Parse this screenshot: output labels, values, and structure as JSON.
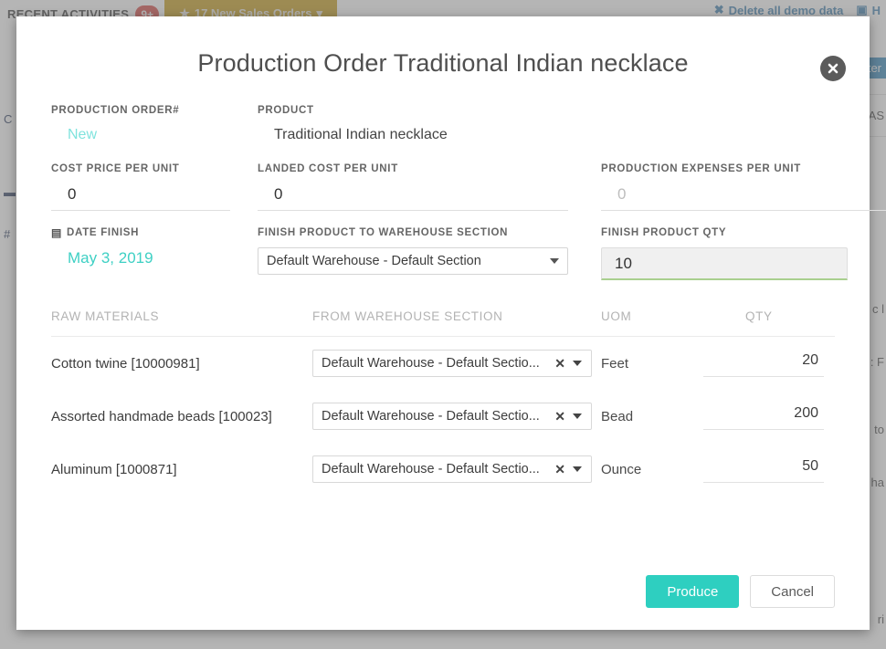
{
  "background": {
    "recent_activities_label": "RECENT ACTIVITIES",
    "recent_activities_badge": "9+",
    "gold_tab_label": "17 New Sales Orders",
    "gold_tab_icon": "star-icon",
    "gold_tab_caret": "▾",
    "right_links": [
      {
        "icon": "trash-icon",
        "label": "Delete all demo data"
      },
      {
        "icon": "help-icon",
        "label": "H"
      }
    ],
    "right_chip_label": "ter",
    "right_fragments": [
      "AS",
      "c l",
      ": F",
      "to",
      "ha",
      "ri"
    ],
    "left_rail_marks": [
      "C",
      "▬",
      "#"
    ]
  },
  "modal": {
    "title": "Production Order Traditional Indian necklace",
    "close_icon": "close-icon",
    "fields": {
      "production_order_no": {
        "label": "PRODUCTION ORDER#",
        "value": "New"
      },
      "product": {
        "label": "PRODUCT",
        "value": "Traditional Indian necklace"
      },
      "cost_price_per_unit": {
        "label": "COST PRICE PER UNIT",
        "value": "0",
        "placeholder": "0"
      },
      "landed_cost_per_unit": {
        "label": "LANDED COST PER UNIT",
        "value": "0",
        "placeholder": "0"
      },
      "production_expenses_per_unit": {
        "label": "PRODUCTION EXPENSES PER UNIT",
        "value": "",
        "placeholder": "0"
      },
      "date_finish": {
        "label": "DATE FINISH",
        "icon": "calendar-icon",
        "value": "May 3, 2019"
      },
      "finish_product_to_warehouse_section": {
        "label": "FINISH PRODUCT TO WAREHOUSE SECTION",
        "value": "Default Warehouse - Default Section",
        "caret_icon": "chevron-down-icon"
      },
      "finish_product_qty": {
        "label": "FINISH PRODUCT QTY",
        "value": "10",
        "focused": true
      }
    },
    "raw_materials_table": {
      "columns": {
        "material": "RAW MATERIALS",
        "warehouse": "FROM WAREHOUSE SECTION",
        "uom": "UOM",
        "qty": "QTY"
      },
      "rows": [
        {
          "material": "Cotton twine [10000981]",
          "warehouse": "Default Warehouse - Default Sectio...",
          "clear_icon": "clear-icon",
          "caret_icon": "chevron-down-icon",
          "uom": "Feet",
          "qty": "20"
        },
        {
          "material": "Assorted handmade beads [100023]",
          "warehouse": "Default Warehouse - Default Sectio...",
          "clear_icon": "clear-icon",
          "caret_icon": "chevron-down-icon",
          "uom": "Bead",
          "qty": "200"
        },
        {
          "material": "Aluminum [1000871]",
          "warehouse": "Default Warehouse - Default Sectio...",
          "clear_icon": "clear-icon",
          "caret_icon": "chevron-down-icon",
          "uom": "Ounce",
          "qty": "50"
        }
      ]
    },
    "footer": {
      "produce_label": "Produce",
      "cancel_label": "Cancel"
    }
  },
  "colors": {
    "accent_teal": "#2ecfc0",
    "accent_light_teal": "#7fe3dd",
    "gold_tab": "#c9a227",
    "badge_red": "#d9534f",
    "link_blue": "#4a88b5",
    "focus_underline_green": "#a9cf8f"
  }
}
